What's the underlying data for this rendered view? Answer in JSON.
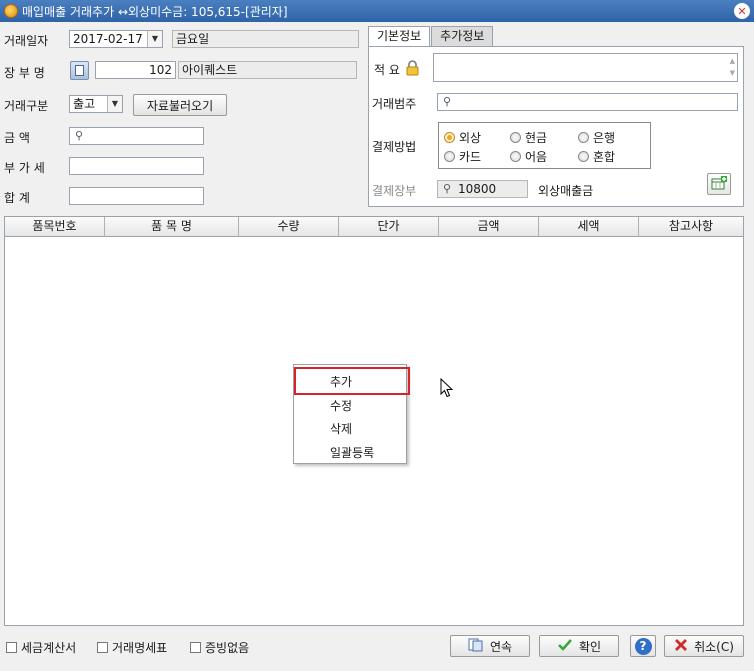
{
  "window": {
    "title": "매입매출 거래추가 ↔외상미수금: 105,615-[관리자]"
  },
  "form": {
    "date_label": "거래일자",
    "date_value": "2017-02-17",
    "weekday": "금요일",
    "ledger_label": "장 부 명",
    "ledger_code": "102",
    "ledger_name": "아이퀘스트",
    "type_label": "거래구분",
    "type_value": "출고",
    "load_button": "자료불러오기",
    "amount_label": "금      액",
    "amount_value": "",
    "vat_label": "부 가 세",
    "vat_value": "",
    "total_label": "합      계",
    "total_value": ""
  },
  "tabs": [
    {
      "label": "기본정보",
      "active": true
    },
    {
      "label": "추가정보",
      "active": false
    }
  ],
  "basic": {
    "memo_label": "적 요",
    "memo_value": "",
    "category_label": "거래범주",
    "category_value": "",
    "payment_label": "결제방법",
    "payment_options": [
      "외상",
      "현금",
      "은행",
      "카드",
      "어음",
      "혼합"
    ],
    "payment_selected": "외상",
    "ledger2_label": "결제장부",
    "ledger2_code": "10800",
    "ledger2_name": "외상매출금"
  },
  "grid": {
    "columns": [
      "품목번호",
      "품 목 명",
      "수량",
      "단가",
      "금액",
      "세액",
      "참고사항"
    ]
  },
  "context_menu": {
    "items": [
      "추가",
      "수정",
      "삭제",
      "일괄등록"
    ],
    "highlighted": "추가"
  },
  "footer": {
    "checkboxes": [
      "세금계산서",
      "거래명세표",
      "증빙없음"
    ],
    "continuous_label": "연속",
    "ok_label": "확인",
    "cancel_label": "취소(C)"
  },
  "colors": {
    "title_bar": "#3a6db3",
    "highlight_border": "#d7232b",
    "radio_selected": "#f2a31b"
  }
}
